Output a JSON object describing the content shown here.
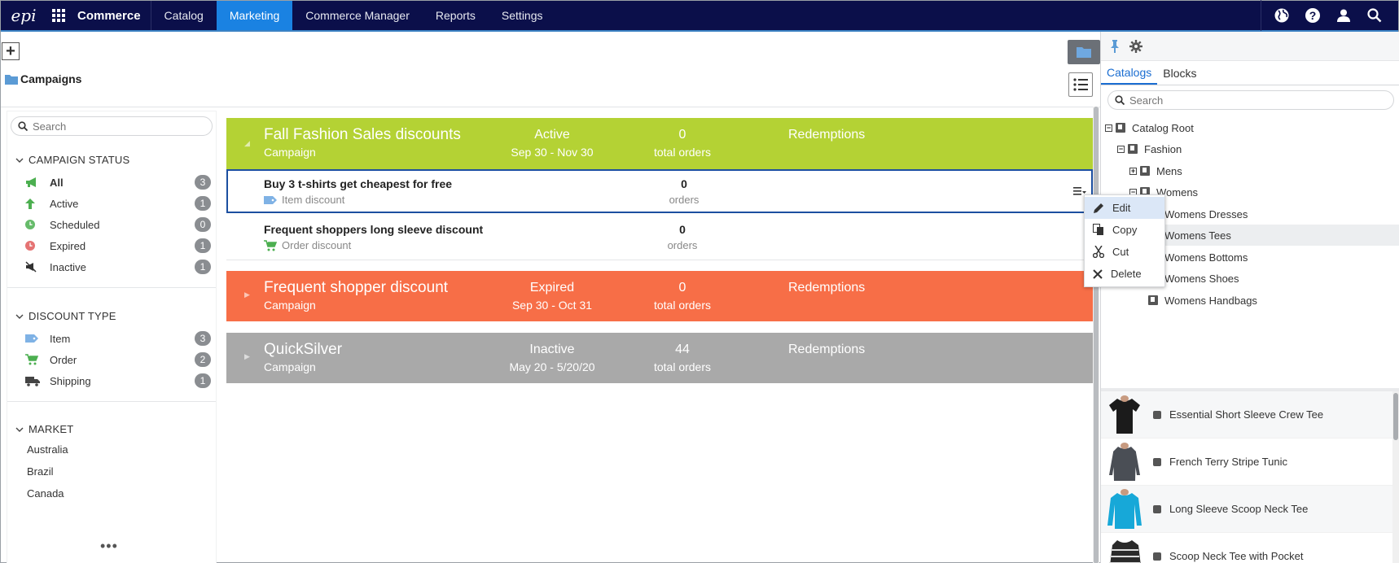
{
  "topnav": {
    "logo": "epi",
    "brand": "Commerce",
    "tabs": [
      "Catalog",
      "Marketing",
      "Commerce Manager",
      "Reports",
      "Settings"
    ],
    "active_tab": "Marketing"
  },
  "breadcrumb": {
    "label": "Campaigns"
  },
  "filters": {
    "search_placeholder": "Search",
    "campaign_status": {
      "title": "CAMPAIGN STATUS",
      "items": [
        {
          "label": "All",
          "count": "3"
        },
        {
          "label": "Active",
          "count": "1"
        },
        {
          "label": "Scheduled",
          "count": "0"
        },
        {
          "label": "Expired",
          "count": "1"
        },
        {
          "label": "Inactive",
          "count": "1"
        }
      ]
    },
    "discount_type": {
      "title": "DISCOUNT TYPE",
      "items": [
        {
          "label": "Item",
          "count": "3"
        },
        {
          "label": "Order",
          "count": "2"
        },
        {
          "label": "Shipping",
          "count": "1"
        }
      ]
    },
    "market": {
      "title": "MARKET",
      "items": [
        "Australia",
        "Brazil",
        "Canada"
      ],
      "more": "•••"
    }
  },
  "campaigns": [
    {
      "name": "Fall Fashion Sales discounts",
      "type": "Campaign",
      "status": "Active",
      "dates": "Sep 30 - Nov 30",
      "count": "0",
      "orders_label": "total orders",
      "redemptions": "Redemptions",
      "color": "#b4d234"
    },
    {
      "name": "Frequent shopper discount",
      "type": "Campaign",
      "status": "Expired",
      "dates": "Sep 30 - Oct 31",
      "count": "0",
      "orders_label": "total orders",
      "redemptions": "Redemptions",
      "color": "#f76e47"
    },
    {
      "name": "QuickSilver",
      "type": "Campaign",
      "status": "Inactive",
      "dates": "May 20 - 5/20/20",
      "count": "44",
      "orders_label": "total orders",
      "redemptions": "Redemptions",
      "color": "#a9a9a9"
    }
  ],
  "discounts": [
    {
      "name": "Buy 3 t-shirts get cheapest for free",
      "type": "Item discount",
      "count": "0",
      "orders_label": "orders"
    },
    {
      "name": "Frequent shoppers long sleeve discount",
      "type": "Order discount",
      "count": "0",
      "orders_label": "orders"
    }
  ],
  "context_menu": {
    "items": [
      "Edit",
      "Copy",
      "Cut",
      "Delete"
    ]
  },
  "right_panel": {
    "tabs": [
      "Catalogs",
      "Blocks"
    ],
    "active_tab": "Catalogs",
    "search_placeholder": "Search",
    "tree": [
      {
        "label": "Catalog Root"
      },
      {
        "label": "Fashion"
      },
      {
        "label": "Mens"
      },
      {
        "label": "Womens"
      },
      {
        "label": "Womens Dresses"
      },
      {
        "label": "Womens Tees"
      },
      {
        "label": "Womens Bottoms"
      },
      {
        "label": "Womens Shoes"
      },
      {
        "label": "Womens Handbags"
      }
    ],
    "products": [
      {
        "name": "Essential Short Sleeve Crew Tee",
        "color": "#1b1b1b"
      },
      {
        "name": "French Terry Stripe Tunic",
        "color": "#4a4e55"
      },
      {
        "name": "Long Sleeve Scoop Neck Tee",
        "color": "#17a8d8"
      },
      {
        "name": "Scoop Neck Tee with Pocket",
        "color": "#2a2a2a"
      }
    ]
  },
  "colors": {
    "nav_bg": "#0b0f4a",
    "accent": "#1a82e2",
    "active_green": "#b4d234",
    "expired_orange": "#f76e47",
    "inactive_gray": "#a9a9a9"
  }
}
